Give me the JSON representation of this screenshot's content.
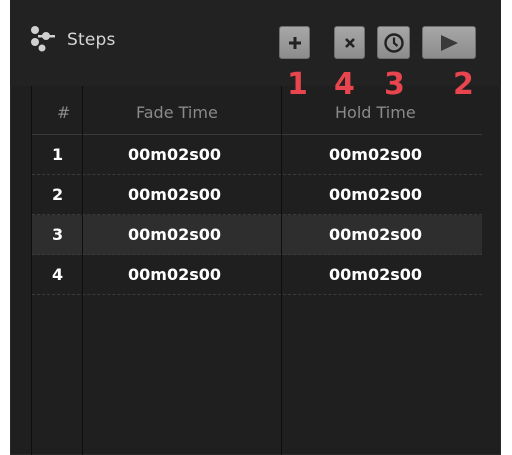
{
  "panel": {
    "title": "Steps",
    "title_icon": "steps-icon"
  },
  "toolbar": {
    "add_icon": "plus-icon",
    "remove_icon": "cross-icon",
    "clock_icon": "clock-icon",
    "play_icon": "play-icon"
  },
  "annotations": [
    "1",
    "4",
    "3",
    "2"
  ],
  "table": {
    "headers": [
      "#",
      "Fade Time",
      "Hold Time"
    ],
    "rows": [
      {
        "num": "1",
        "fade": "00m02s00",
        "hold": "00m02s00"
      },
      {
        "num": "2",
        "fade": "00m02s00",
        "hold": "00m02s00"
      },
      {
        "num": "3",
        "fade": "00m02s00",
        "hold": "00m02s00"
      },
      {
        "num": "4",
        "fade": "00m02s00",
        "hold": "00m02s00"
      }
    ]
  },
  "colors": {
    "panel_bg": "#1f1f1f",
    "selected_row": "#2e2e2e",
    "annotation": "#e8454f",
    "button": "#9a9a9a"
  }
}
